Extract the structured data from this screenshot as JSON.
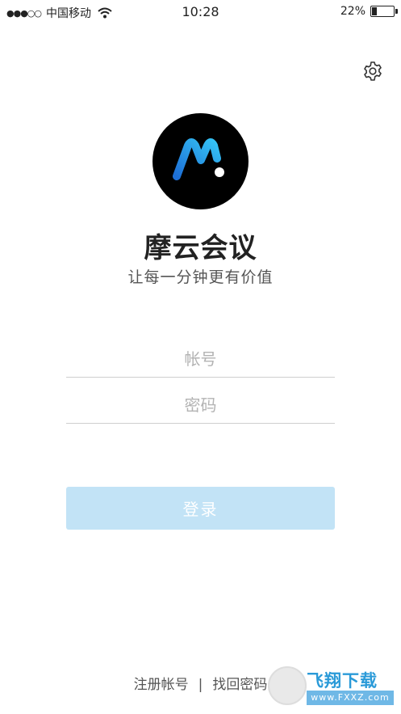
{
  "status_bar": {
    "signal": "●●●○○",
    "carrier": "中国移动",
    "time": "10:28",
    "battery": "22%",
    "battery_level": 0.22
  },
  "settings_icon": "gear-icon",
  "logo_icon": "m-logo-icon",
  "app": {
    "title": "摩云会议",
    "slogan": "让每一分钟更有价值"
  },
  "form": {
    "account_placeholder": "帐号",
    "password_placeholder": "密码",
    "login_label": "登录"
  },
  "footer": {
    "register": "注册帐号",
    "separator": "|",
    "recover": "找回密码"
  },
  "watermark": {
    "title": "飞翔下载",
    "url": "www.FXXZ.com"
  },
  "colors": {
    "login_button": "#c2e3f6",
    "logo_bg": "#000000",
    "logo_accent": "#2b9be8"
  }
}
